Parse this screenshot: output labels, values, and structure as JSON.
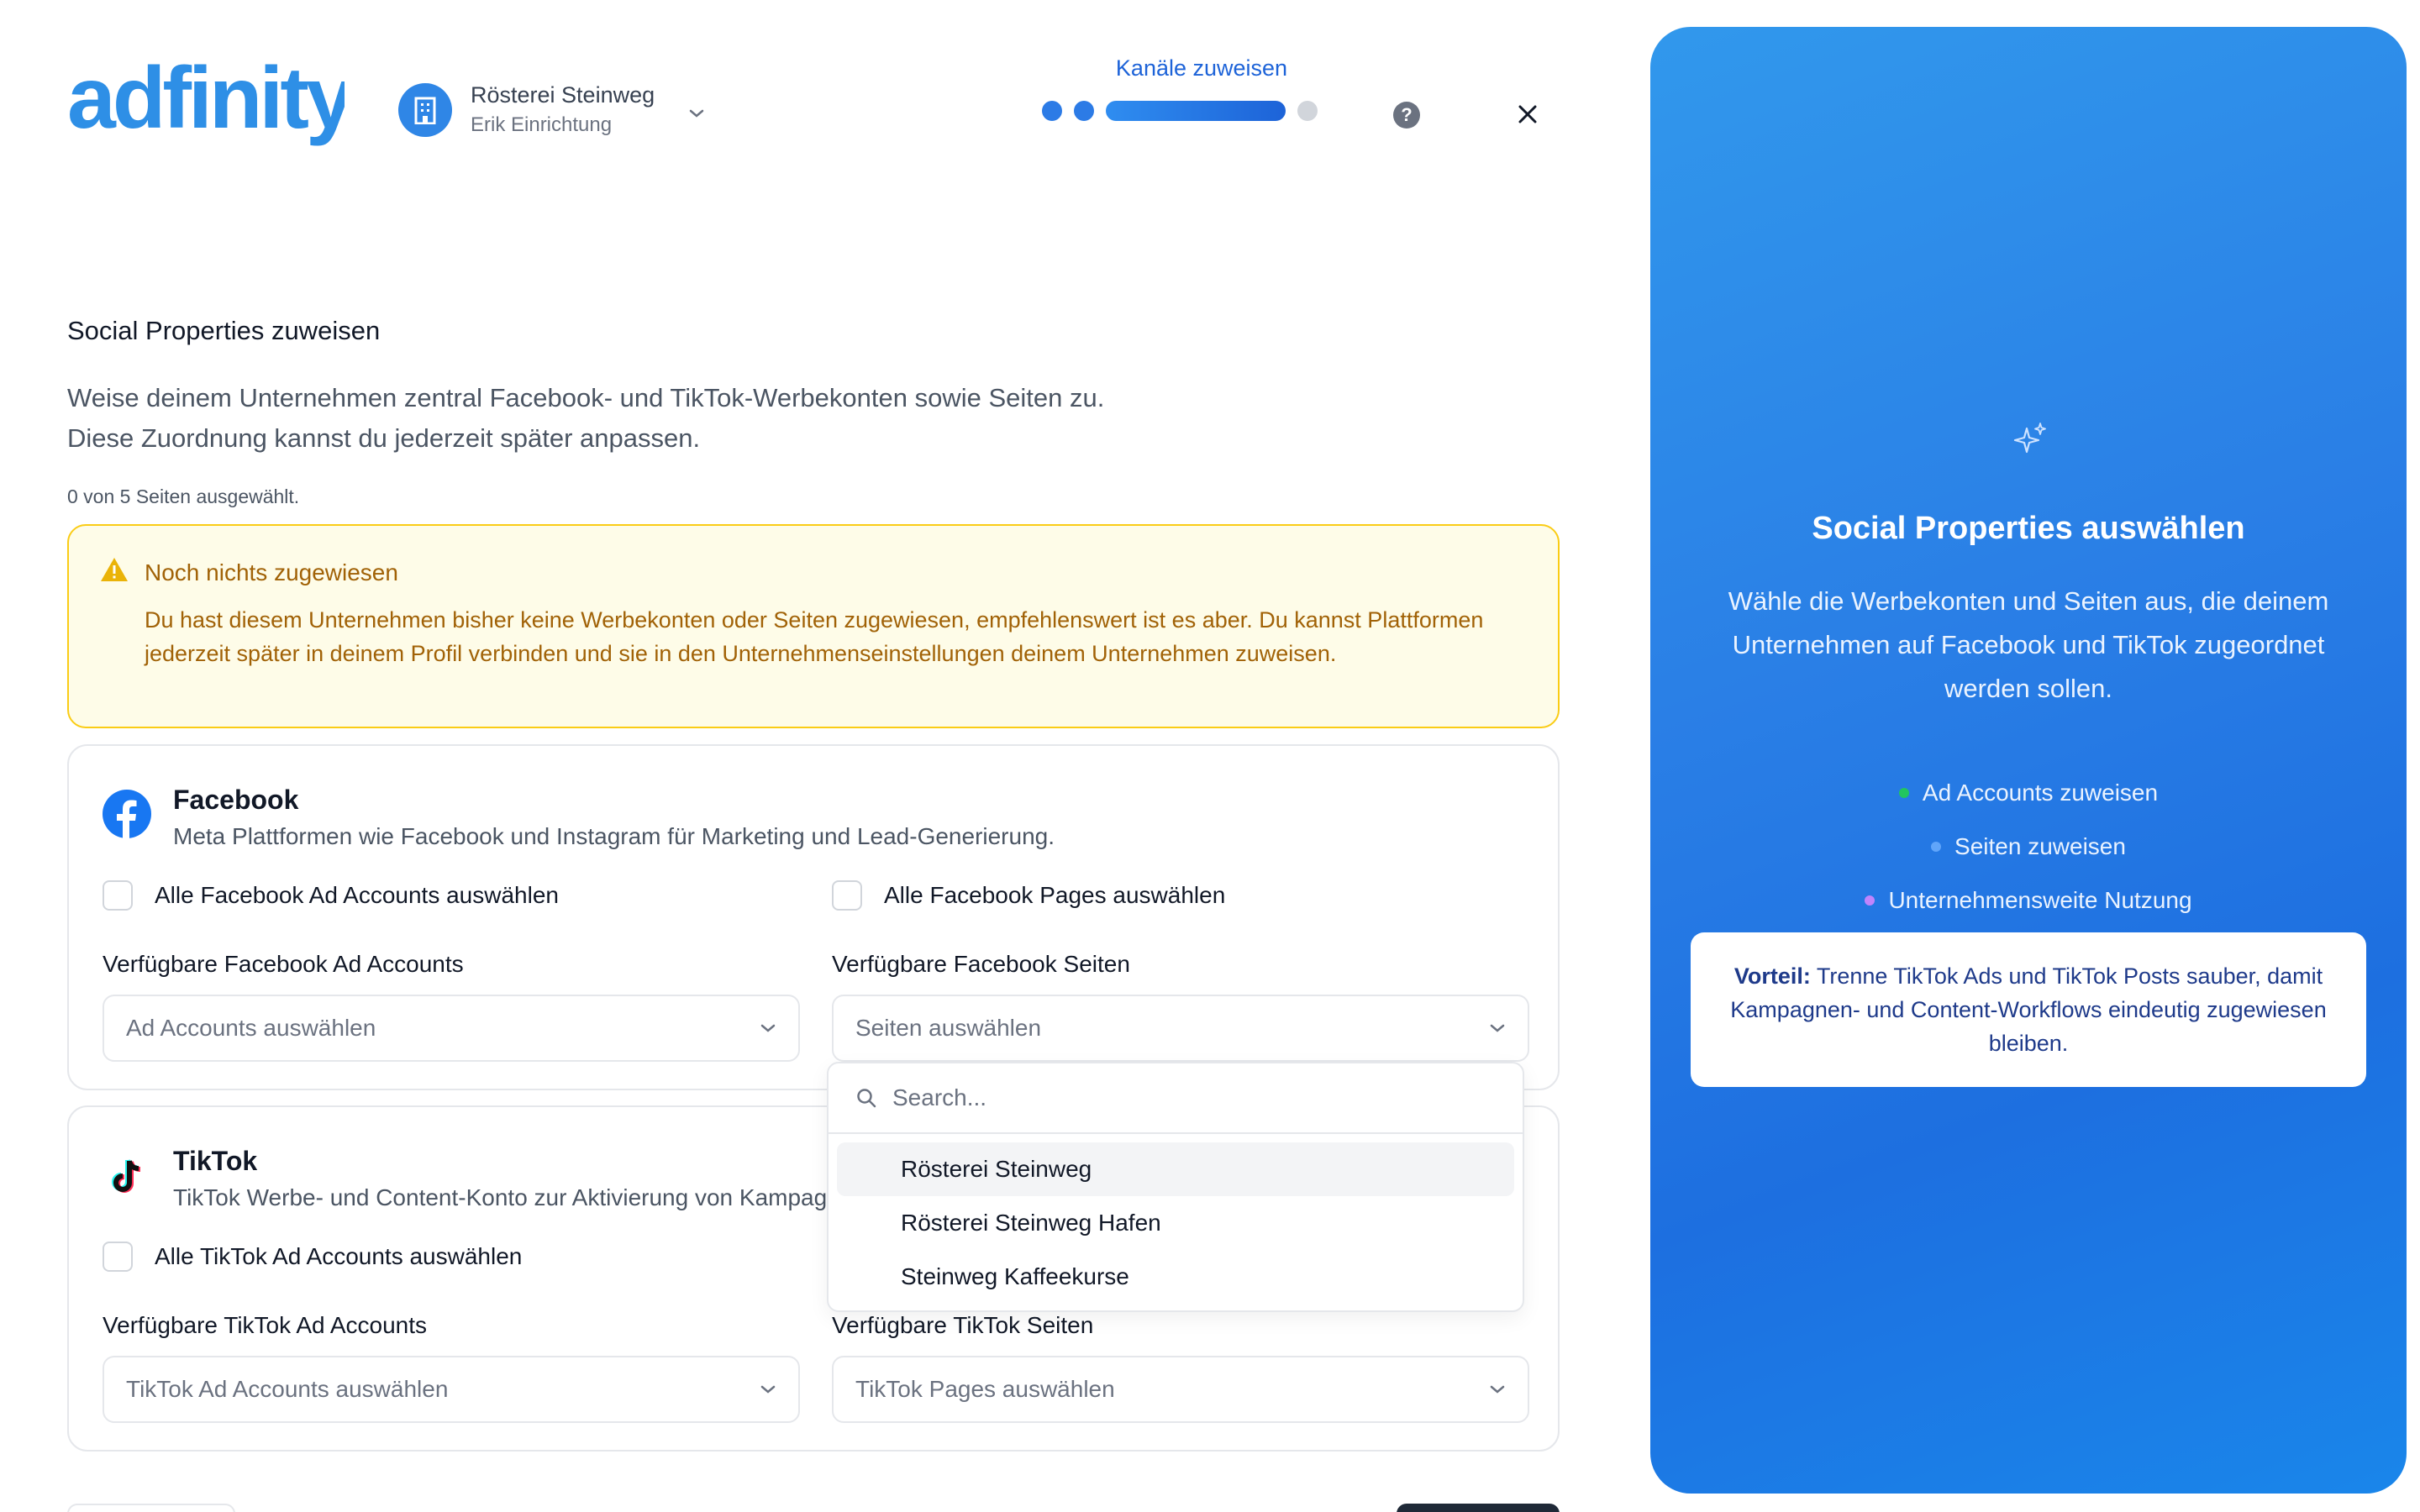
{
  "brand": {
    "logo_text": "adfinity"
  },
  "company": {
    "name": "Rösterei Steinweg",
    "subtitle": "Erik Einrichtung"
  },
  "stepper": {
    "title": "Kanäle zuweisen",
    "steps_total": 4,
    "current_step": 3
  },
  "page": {
    "title": "Social Properties zuweisen",
    "description_line1": "Weise deinem Unternehmen zentral Facebook- und TikTok-Werbekonten sowie Seiten zu.",
    "description_line2": "Diese Zuordnung kannst du jederzeit später anpassen.",
    "selection_count": "0 von 5 Seiten ausgewählt."
  },
  "alert": {
    "title": "Noch nichts zugewiesen",
    "body": "Du hast diesem Unternehmen bisher keine Werbekonten oder Seiten zugewiesen, empfehlenswert ist es aber. Du kannst Plattformen jederzeit später in deinem Profil verbinden und sie in den Unternehmenseinstellungen deinem Unternehmen zuweisen."
  },
  "facebook": {
    "title": "Facebook",
    "subtitle": "Meta Plattformen wie Facebook und Instagram für Marketing und Lead-Generierung.",
    "select_all_ads": "Alle Facebook Ad Accounts auswählen",
    "select_all_pages": "Alle Facebook Pages auswählen",
    "ads_label": "Verfügbare Facebook Ad Accounts",
    "ads_placeholder": "Ad Accounts auswählen",
    "pages_label": "Verfügbare Facebook Seiten",
    "pages_placeholder": "Seiten auswählen"
  },
  "dropdown": {
    "search_placeholder": "Search...",
    "options": [
      "Rösterei Steinweg",
      "Rösterei Steinweg Hafen",
      "Steinweg Kaffeekurse"
    ]
  },
  "tiktok": {
    "title": "TikTok",
    "subtitle": "TikTok Werbe- und Content-Konto zur Aktivierung von Kampagnen.",
    "select_all_ads": "Alle TikTok Ad Accounts auswählen",
    "ads_label": "Verfügbare TikTok Ad Accounts",
    "ads_placeholder": "TikTok Ad Accounts auswählen",
    "pages_label": "Verfügbare TikTok Seiten",
    "pages_placeholder": "TikTok Pages auswählen"
  },
  "side_panel": {
    "title": "Social Properties auswählen",
    "text": "Wähle die Werbekonten und Seiten aus, die deinem Unternehmen auf Facebook und TikTok zugeordnet werden sollen.",
    "bullets": [
      {
        "label": "Ad Accounts zuweisen",
        "color": "#22c55e"
      },
      {
        "label": "Seiten zuweisen",
        "color": "#60a5fa"
      },
      {
        "label": "Unternehmensweite Nutzung",
        "color": "#c084fc"
      }
    ],
    "benefit_label": "Vorteil:",
    "benefit_text": "Trenne TikTok Ads und TikTok Posts sauber, damit Kampagnen- und Content-Workflows eindeutig zugewiesen bleiben."
  },
  "colors": {
    "primary": "#2c7be6",
    "alert_bg": "#fefce8",
    "alert_text": "#a16207",
    "panel": "#2a7fe6"
  },
  "icons": [
    "building-icon",
    "chevron-down-icon",
    "help-icon",
    "close-icon",
    "warning-icon",
    "facebook-icon",
    "tiktok-icon",
    "search-icon",
    "sparkle-icon"
  ]
}
